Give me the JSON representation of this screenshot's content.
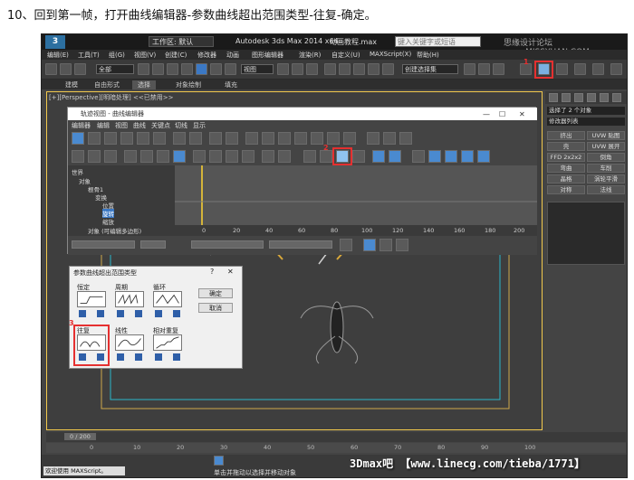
{
  "caption": "10、回到第一帧，打开曲线编辑器-参数曲线超出范围类型-往复-确定。",
  "titlebar": {
    "workspace": "工作区: 默认",
    "app_title": "Autodesk 3ds Max  2014 x64",
    "document": "动画教程.max",
    "search_placeholder": "键入关键字或短语",
    "watermark": "思缘设计论坛 www.MISSYUAN.COM"
  },
  "menubar": {
    "items": [
      "编辑(E)",
      "工具(T)",
      "组(G)",
      "视图(V)",
      "创建(C)",
      "修改器",
      "动画",
      "图形编辑器",
      "渲染(R)",
      "自定义(U)",
      "MAXScript(X)",
      "帮助(H)"
    ]
  },
  "toolbar": {
    "selection_filter": "全部",
    "view_select": "视图",
    "selection_set": "创建选择集"
  },
  "ribbon": {
    "tabs": [
      "建模",
      "自由形式",
      "选择",
      "对象绘制",
      "填充"
    ],
    "active": "选择"
  },
  "viewport": {
    "label": "[+][Perspective][明暗处理]  <<已禁用>>"
  },
  "command_panel": {
    "object_name": "选择了 2 个对象",
    "modifier_list": "修改器列表",
    "buttons": [
      "挤出",
      "UVW 贴图",
      "壳",
      "UVW 展开",
      "FFD 2x2x2",
      "倒角",
      "弯曲",
      "车削",
      "晶格",
      "涡轮平滑",
      "对称",
      "法线"
    ]
  },
  "curve_editor": {
    "title": "轨迹视图 - 曲线编辑器",
    "controls": [
      "—",
      "☐",
      "✕"
    ],
    "menu": [
      "编辑器",
      "编辑",
      "视图",
      "曲线",
      "关键点",
      "切线",
      "显示"
    ],
    "tree": [
      "世界",
      "对象",
      "根骨1",
      "变换",
      "位置",
      "旋转",
      "缩放",
      "对象 (可编辑多边形)"
    ],
    "ruler_ticks": [
      "0",
      "20",
      "40",
      "60",
      "80",
      "100",
      "120",
      "140",
      "160",
      "180",
      "200"
    ],
    "marker_2": "2"
  },
  "dialog": {
    "title": "参数曲线超出范围类型",
    "help": "?",
    "close": "✕",
    "options": [
      "恒定",
      "周期",
      "循环",
      "往复",
      "线性",
      "相对重复"
    ],
    "ok": "确定",
    "cancel": "取消",
    "marker_3": "3"
  },
  "markers": {
    "marker_1": "1"
  },
  "timeline": {
    "frame": "0 / 200",
    "ticks": [
      "0",
      "10",
      "20",
      "30",
      "40",
      "50",
      "60",
      "70",
      "80",
      "90",
      "100"
    ]
  },
  "statusbar": {
    "maxscript": "欢迎使用 MAXScript。",
    "hint": "单击并拖动以选择并移动对象",
    "watermark": "3Dmax吧 【www.linecg.com/tieba/1771】"
  }
}
